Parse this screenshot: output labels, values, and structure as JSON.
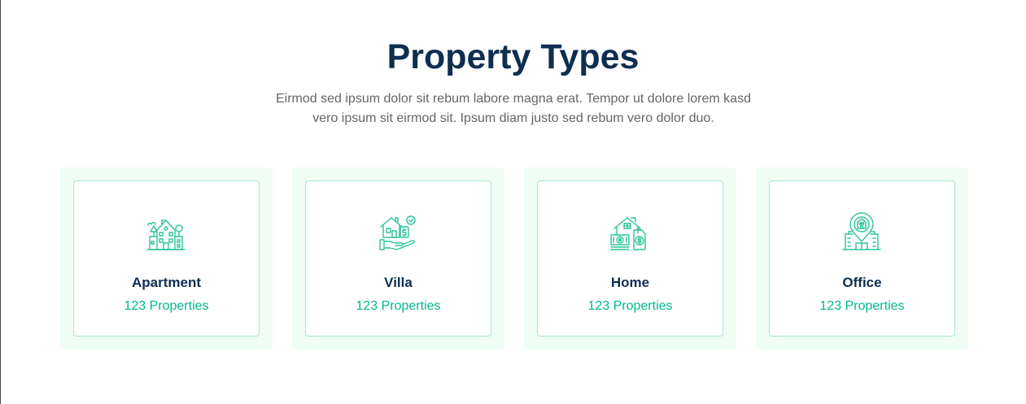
{
  "section": {
    "title": "Property Types",
    "subtitle": "Eirmod sed ipsum dolor sit rebum labore magna erat. Tempor ut dolore lorem kasd vero ipsum sit eirmod sit. Ipsum diam justo sed rebum vero dolor duo."
  },
  "colors": {
    "title": "#0e2e50",
    "accent": "#00b98e",
    "card_background": "#effdf5",
    "body_text": "#666565"
  },
  "property_types": [
    {
      "name": "Apartment",
      "count_label": "123 Properties",
      "icon": "apartment-icon"
    },
    {
      "name": "Villa",
      "count_label": "123 Properties",
      "icon": "villa-icon"
    },
    {
      "name": "Home",
      "count_label": "123 Properties",
      "icon": "home-icon"
    },
    {
      "name": "Office",
      "count_label": "123 Properties",
      "icon": "office-icon"
    }
  ]
}
